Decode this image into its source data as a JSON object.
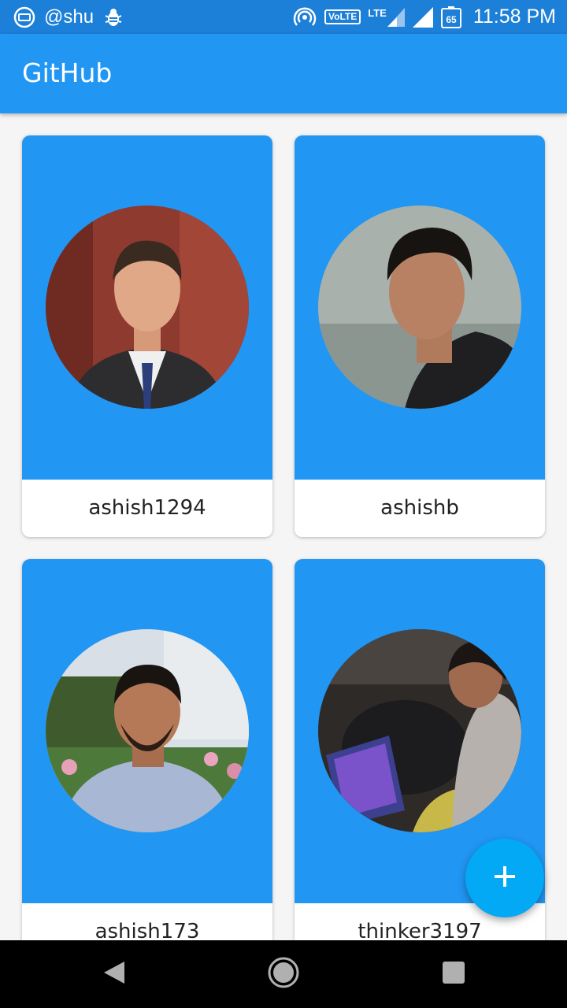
{
  "status_bar": {
    "handle": "@shu",
    "network_badge": "VoLTE",
    "lte_label": "LTE",
    "battery_level": "65",
    "time": "11:58 PM",
    "icons": [
      "tv-icon",
      "bug-icon",
      "hotspot-icon",
      "signal-icon",
      "battery-icon"
    ]
  },
  "app_bar": {
    "title": "GitHub"
  },
  "users": [
    {
      "username": "ashish1294",
      "avatar": "avatar-photo"
    },
    {
      "username": "ashishb",
      "avatar": "avatar-photo"
    },
    {
      "username": "ashish173",
      "avatar": "avatar-photo"
    },
    {
      "username": "thinker3197",
      "avatar": "avatar-photo"
    }
  ],
  "fab": {
    "icon": "plus-icon"
  },
  "nav_bar": {
    "icons": [
      "back-icon",
      "home-icon",
      "recents-icon"
    ]
  },
  "colors": {
    "status_bar": "#1c7fd8",
    "primary": "#2196f3",
    "accent": "#03a9f4",
    "background": "#f5f5f5"
  }
}
